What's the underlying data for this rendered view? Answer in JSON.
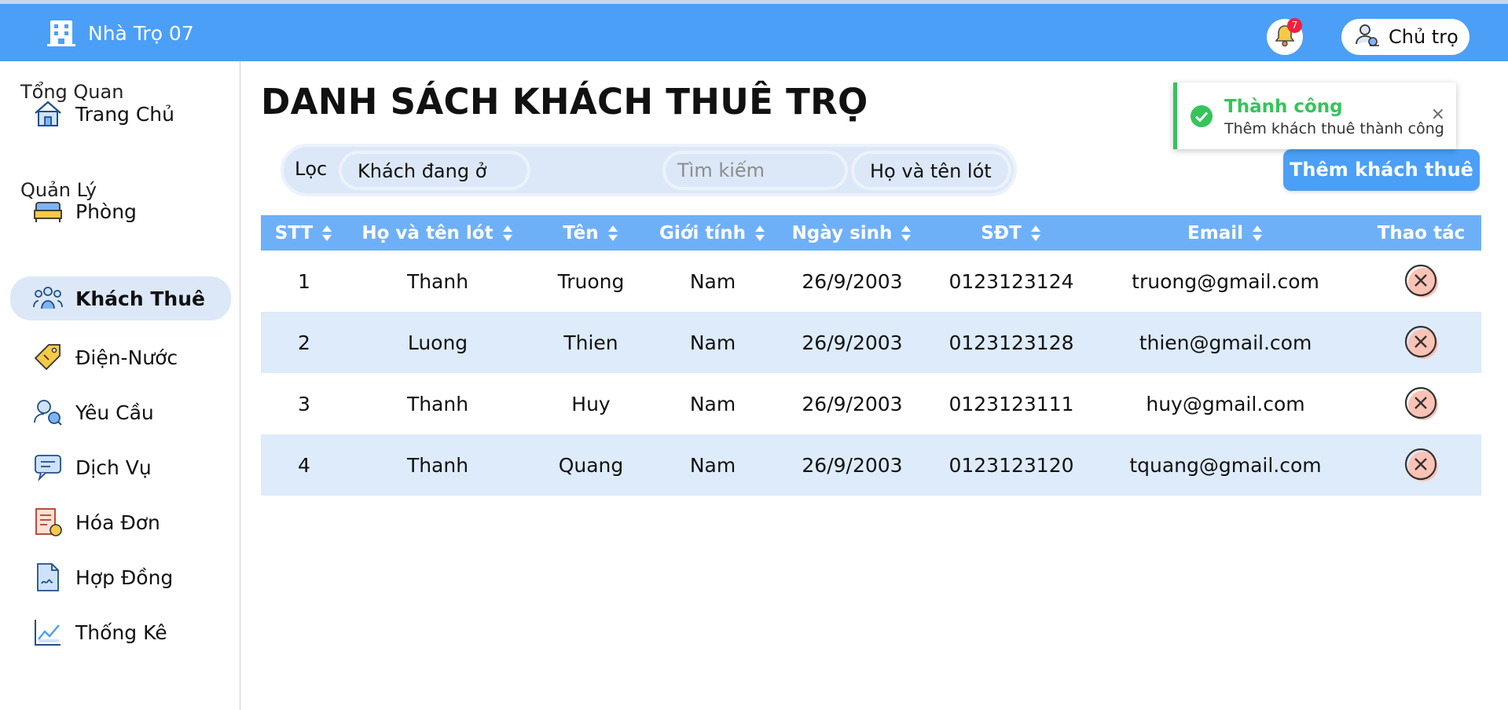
{
  "header": {
    "brand_name": "Nhà Trọ 07",
    "notification_count": "7",
    "owner_label": "Chủ trọ"
  },
  "sidebar": {
    "section_overview": "Tổng Quan",
    "section_manage": "Quản Lý",
    "items": [
      {
        "label": "Trang Chủ",
        "icon": "home-icon"
      },
      {
        "label": "Phòng",
        "icon": "bed-icon"
      },
      {
        "label": "Khách Thuê",
        "icon": "tenants-icon",
        "active": true
      },
      {
        "label": "Điện-Nước",
        "icon": "price-tag-icon"
      },
      {
        "label": "Yêu Cầu",
        "icon": "request-icon"
      },
      {
        "label": "Dịch Vụ",
        "icon": "service-chat-icon"
      },
      {
        "label": "Hóa Đơn",
        "icon": "invoice-icon"
      },
      {
        "label": "Hợp Đồng",
        "icon": "contract-icon"
      },
      {
        "label": "Thống Kê",
        "icon": "chart-icon"
      }
    ]
  },
  "main": {
    "title": "DANH SÁCH KHÁCH THUÊ TRỌ",
    "filter_label": "Lọc",
    "filter_value": "Khách đang ở",
    "search_placeholder": "Tìm kiếm",
    "search_field": "Họ và tên lót",
    "add_button": "Thêm khách thuê"
  },
  "toast": {
    "title": "Thành công",
    "message": "Thêm khách thuê thành công",
    "close": "×"
  },
  "table": {
    "headers": [
      "STT",
      "Họ và tên lót",
      "Tên",
      "Giới tính",
      "Ngày sinh",
      "SĐT",
      "Email",
      "Thao tác"
    ],
    "rows": [
      [
        "1",
        "Thanh",
        "Truong",
        "Nam",
        "26/9/2003",
        "0123123124",
        "truong@gmail.com"
      ],
      [
        "2",
        "Luong",
        "Thien",
        "Nam",
        "26/9/2003",
        "0123123128",
        "thien@gmail.com"
      ],
      [
        "3",
        "Thanh",
        "Huy",
        "Nam",
        "26/9/2003",
        "0123123111",
        "huy@gmail.com"
      ],
      [
        "4",
        "Thanh",
        "Quang",
        "Nam",
        "26/9/2003",
        "0123123120",
        "tquang@gmail.com"
      ]
    ]
  },
  "colors": {
    "header_blue": "#4b9ff7",
    "table_head": "#6eb0f8",
    "row_alt": "#ddebfa",
    "success": "#35c45a",
    "delete_red": "#e8413c"
  }
}
